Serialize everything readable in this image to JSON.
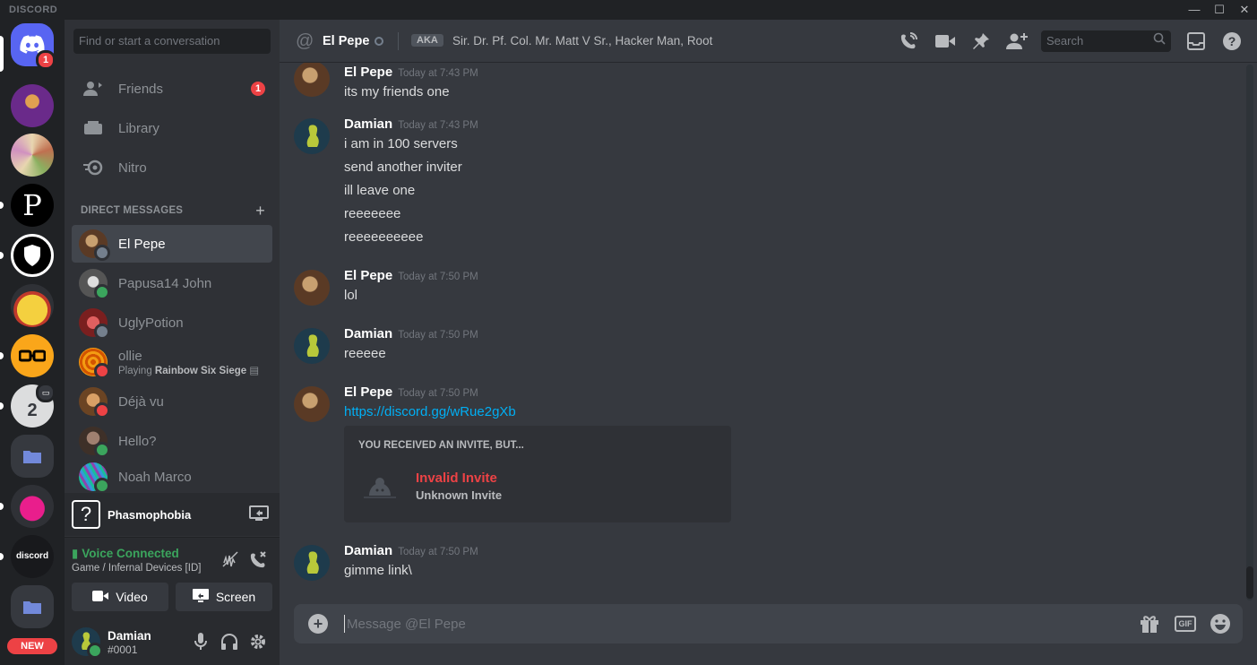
{
  "titlebar": {
    "brand": "DISCORD"
  },
  "rail": {
    "home_badge": "1",
    "new_label": "NEW",
    "bio_label": "discord"
  },
  "sidebar": {
    "search_placeholder": "Find or start a conversation",
    "nav": [
      {
        "label": "Friends",
        "badge": "1"
      },
      {
        "label": "Library"
      },
      {
        "label": "Nitro"
      }
    ],
    "dm_header": "DIRECT MESSAGES",
    "dms": [
      {
        "name": "El Pepe",
        "status": "offline",
        "active": true
      },
      {
        "name": "Papusa14 John",
        "status": "online"
      },
      {
        "name": "UglyPotion",
        "status": "offline"
      },
      {
        "name": "ollie",
        "status": "dnd",
        "activity_prefix": "Playing",
        "activity": "Rainbow Six Siege"
      },
      {
        "name": "Déjà vu",
        "status": "dnd"
      },
      {
        "name": "Hello?",
        "status": "online"
      },
      {
        "name": "Noah Marco",
        "status": "online"
      }
    ],
    "game": {
      "name": "Phasmophobia"
    },
    "voice": {
      "title": "Voice Connected",
      "channel": "Game / Infernal Devices [ID]",
      "video_label": "Video",
      "screen_label": "Screen"
    },
    "user": {
      "name": "Damian",
      "tag": "#0001"
    }
  },
  "chat": {
    "header": {
      "name": "El Pepe",
      "aka": "AKA",
      "aliases": "Sir. Dr. Pf. Col. Mr. Matt V Sr., Hacker Man, Root",
      "search_placeholder": "Search"
    },
    "messages": [
      {
        "author": "El Pepe",
        "time": "Today at 7:43 PM",
        "lines": [
          "its my friends one"
        ]
      },
      {
        "author": "Damian",
        "time": "Today at 7:43 PM",
        "lines": [
          "i am in 100 servers",
          "send another inviter",
          "ill leave one",
          "reeeeeee",
          "reeeeeeeeee"
        ]
      },
      {
        "author": "El Pepe",
        "time": "Today at 7:50 PM",
        "lines": [
          "lol"
        ]
      },
      {
        "author": "Damian",
        "time": "Today at 7:50 PM",
        "lines": [
          "reeeee"
        ]
      },
      {
        "author": "El Pepe",
        "time": "Today at 7:50 PM",
        "link": "https://discord.gg/wRue2gXb"
      },
      {
        "author": "Damian",
        "time": "Today at 7:50 PM",
        "lines": [
          "gimme link\\"
        ]
      }
    ],
    "invite": {
      "heading": "YOU RECEIVED AN INVITE, BUT...",
      "title": "Invalid Invite",
      "subtitle": "Unknown Invite"
    },
    "composer": {
      "placeholder": "Message @El Pepe",
      "gif_label": "GIF"
    }
  },
  "colors": {
    "blurple": "#5865f2",
    "online": "#3ba55d",
    "dnd": "#ed4245",
    "link": "#00aff4",
    "bg_chat": "#36393f",
    "bg_sidebar": "#2f3136",
    "bg_rail": "#202225"
  }
}
